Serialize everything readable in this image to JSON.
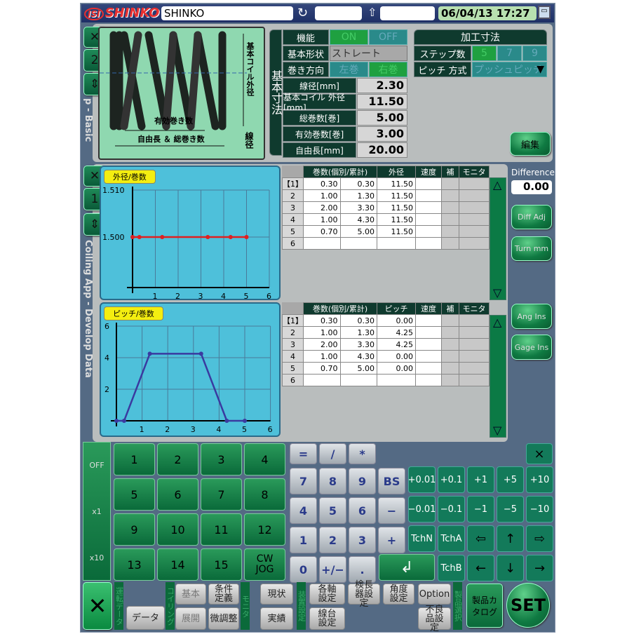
{
  "header": {
    "logo": "SHINKO",
    "name_field": "SHINKO",
    "field2": "",
    "field3": "",
    "datetime": "06/04/13 17:27",
    "refresh_icon": "refresh-icon",
    "upload_icon": "upload-icon",
    "save_icon": "save-icon"
  },
  "colors": {
    "accent_green": "#1fa040",
    "label_dark": "#0f3a2e",
    "chart_bg": "#4ec0da",
    "od_line": "#e02020",
    "pitch_line": "#3a3aa0"
  },
  "side_tabs": {
    "top": [
      "✕",
      "2",
      "⇕"
    ],
    "mid": [
      "✕",
      "1",
      "⇕"
    ],
    "vertical_basic": "p - Basic",
    "vertical_develop": "Coiling App - Develop Data"
  },
  "spring": {
    "outer_dia_label": "基本コイル外径",
    "active_label": "有効巻き数",
    "free_label": "自由長 ＆ 総巻き数",
    "wire_label": "線径"
  },
  "basic": {
    "side_label": "基本寸法",
    "function_label": "機能",
    "on": "ON",
    "off": "OFF",
    "shape_label": "基本形状",
    "shape_value": "ストレート",
    "direction_label": "巻き方向",
    "left": "左巻",
    "right": "右巻",
    "rows": [
      {
        "label": "線径[mm]",
        "value": "2.30"
      },
      {
        "label": "基本コイル 外径[mm]",
        "value": "11.50"
      },
      {
        "label": "総巻数[巻]",
        "value": "5.00"
      },
      {
        "label": "有効巻数[巻]",
        "value": "3.00"
      },
      {
        "label": "自由長[mm]",
        "value": "20.00"
      }
    ]
  },
  "process": {
    "title": "加工寸法",
    "steps_label": "ステップ数",
    "steps": [
      "5",
      "7",
      "9"
    ],
    "steps_selected": "5",
    "pitch_label": "ピッチ 方式",
    "pitch_value": "プッシュピッチ",
    "edit": "編集"
  },
  "right": {
    "difference_label": "Difference",
    "difference_value": "0.00",
    "diff_adj": "Diff Adj",
    "turn_mm": "Turn mm",
    "ang_ins": "Ang Ins",
    "gage_ins": "Gage Ins"
  },
  "od_table": {
    "headers": [
      "巻数(個別/累計)",
      "外径",
      "速度",
      "補",
      "モニタ"
    ],
    "rows": [
      [
        "【1】",
        "0.30",
        "0.30",
        "11.50"
      ],
      [
        "2",
        "1.00",
        "1.30",
        "11.50"
      ],
      [
        "3",
        "2.00",
        "3.30",
        "11.50"
      ],
      [
        "4",
        "1.00",
        "4.30",
        "11.50"
      ],
      [
        "5",
        "0.70",
        "5.00",
        "11.50"
      ],
      [
        "6",
        "",
        "",
        ""
      ]
    ]
  },
  "pitch_table": {
    "headers": [
      "巻数(個別/累計)",
      "ピッチ",
      "速度",
      "補",
      "モニタ"
    ],
    "rows": [
      [
        "【1】",
        "0.30",
        "0.30",
        "0.00"
      ],
      [
        "2",
        "1.00",
        "1.30",
        "4.25"
      ],
      [
        "3",
        "2.00",
        "3.30",
        "4.25"
      ],
      [
        "4",
        "1.00",
        "4.30",
        "0.00"
      ],
      [
        "5",
        "0.70",
        "5.00",
        "0.00"
      ],
      [
        "6",
        "",
        "",
        ""
      ]
    ]
  },
  "chart_data": [
    {
      "type": "line",
      "title": "外径/巻数",
      "x": [
        0,
        0.3,
        1.3,
        3.3,
        4.3,
        5.0
      ],
      "y": [
        1.5,
        1.5,
        1.5,
        1.5,
        1.5,
        1.5
      ],
      "xlim": [
        0,
        6
      ],
      "ylim": [
        1.49,
        1.51
      ],
      "xticks": [
        "1",
        "2",
        "3",
        "4",
        "5",
        "6"
      ],
      "yticks": [
        "1.510",
        "1.500"
      ],
      "ytick_values": [
        1.51,
        1.5
      ],
      "grid": true,
      "color": "#e02020"
    },
    {
      "type": "line",
      "title": "ピッチ/巻数",
      "x": [
        0,
        0.3,
        1.3,
        3.3,
        4.3,
        5.0
      ],
      "y": [
        0,
        0,
        4.25,
        4.25,
        0,
        0
      ],
      "xlim": [
        0,
        6
      ],
      "ylim": [
        0,
        6
      ],
      "xticks": [
        "1",
        "2",
        "3",
        "4",
        "5",
        "6"
      ],
      "yticks": [
        "6",
        "4",
        "2"
      ],
      "ytick_values": [
        6,
        4,
        2
      ],
      "grid": true,
      "color": "#3a3aa0"
    }
  ],
  "keypad": {
    "mult": [
      "OFF",
      "x1",
      "x10"
    ],
    "numbers": [
      "1",
      "2",
      "3",
      "4",
      "5",
      "6",
      "7",
      "8",
      "9",
      "10",
      "11",
      "12",
      "13",
      "14",
      "15",
      "CW JOG"
    ],
    "calc": [
      [
        "=",
        "/",
        "*",
        ""
      ],
      [
        "7",
        "8",
        "9",
        "BS"
      ],
      [
        "4",
        "5",
        "6",
        "−"
      ],
      [
        "1",
        "2",
        "3",
        "+"
      ],
      [
        "0",
        "+/−",
        "."
      ]
    ],
    "enter": "↲",
    "close": "×",
    "ops": [
      [
        "+0.01",
        "+0.1",
        "+1",
        "+5",
        "+10"
      ],
      [
        "−0.01",
        "−0.1",
        "−1",
        "−5",
        "−10"
      ],
      [
        "TchN",
        "TchA",
        "⇦",
        "↑",
        "⇨"
      ],
      [
        "",
        "TchB",
        "←",
        "↓",
        "→"
      ]
    ]
  },
  "bottom": {
    "close": "✕",
    "groups": {
      "run": "運転データ",
      "coil": "コイリング",
      "monitor": "モニタ",
      "device": "装置設定",
      "product": "製品選択"
    },
    "data": "データ",
    "basic": "基本",
    "condition": "条件定義",
    "expand": "展開",
    "fine": "微調整",
    "current": "現状",
    "results": "実績",
    "axis": "各軸設定",
    "measure": "検長器設定",
    "angle": "角度設定",
    "option": "Option",
    "wire_stand": "線台設定",
    "defect": "不良品設定",
    "catalog": "製品カタログ",
    "set": "SET"
  }
}
